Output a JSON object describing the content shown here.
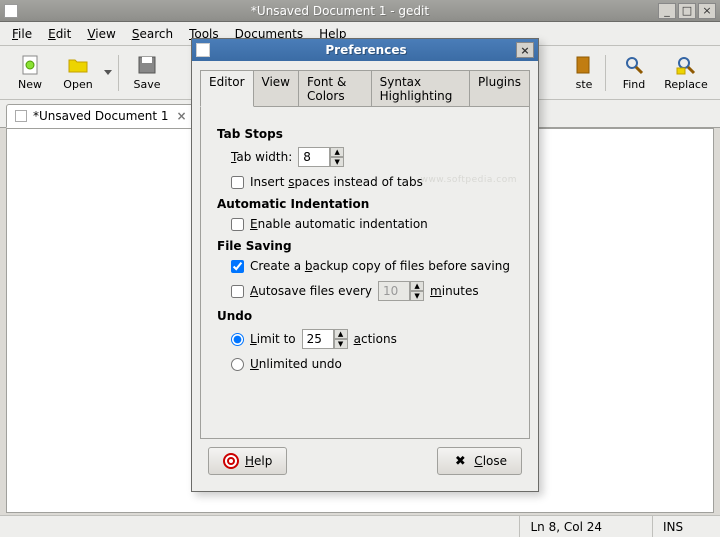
{
  "window": {
    "title": "*Unsaved Document 1 - gedit",
    "minimize": "_",
    "maximize": "□",
    "close": "×"
  },
  "menus": {
    "file": "File",
    "edit": "Edit",
    "view": "View",
    "search": "Search",
    "tools": "Tools",
    "documents": "Documents",
    "help": "Help"
  },
  "toolbar": {
    "new": "New",
    "open": "Open",
    "save": "Save",
    "paste": "ste",
    "find": "Find",
    "replace": "Replace"
  },
  "doctab": {
    "label": "*Unsaved Document 1",
    "close": "×"
  },
  "statusbar": {
    "cursor": "Ln 8, Col 24",
    "mode": "INS"
  },
  "dialog": {
    "title": "Preferences",
    "close": "×",
    "tabs": {
      "editor": "Editor",
      "view": "View",
      "fonts": "Font & Colors",
      "syntax": "Syntax Highlighting",
      "plugins": "Plugins"
    },
    "watermark": "www.softpedia.com",
    "sections": {
      "tab_stops": {
        "title": "Tab Stops",
        "tab_width_label_pre": "T",
        "tab_width_label_post": "ab width:",
        "tab_width_value": "8",
        "insert_spaces_pre": "Insert ",
        "insert_spaces_und": "s",
        "insert_spaces_post": "paces instead of tabs"
      },
      "auto_indent": {
        "title": "Automatic Indentation",
        "enable_und": "E",
        "enable_post": "nable automatic indentation"
      },
      "file_saving": {
        "title": "File Saving",
        "backup_pre": "Create a ",
        "backup_und": "b",
        "backup_post": "ackup copy of files before saving",
        "autosave_und": "A",
        "autosave_pre": "utosave files every",
        "autosave_value": "10",
        "autosave_unit_und": "m",
        "autosave_unit_post": "inutes"
      },
      "undo": {
        "title": "Undo",
        "limit_und": "L",
        "limit_pre": "imit to",
        "limit_value": "25",
        "limit_unit_und": "a",
        "limit_unit_post": "ctions",
        "unlimited_und": "U",
        "unlimited_post": "nlimited undo"
      }
    },
    "buttons": {
      "help_und": "H",
      "help_post": "elp",
      "close_und": "C",
      "close_post": "lose",
      "close_icon": "✖"
    }
  }
}
